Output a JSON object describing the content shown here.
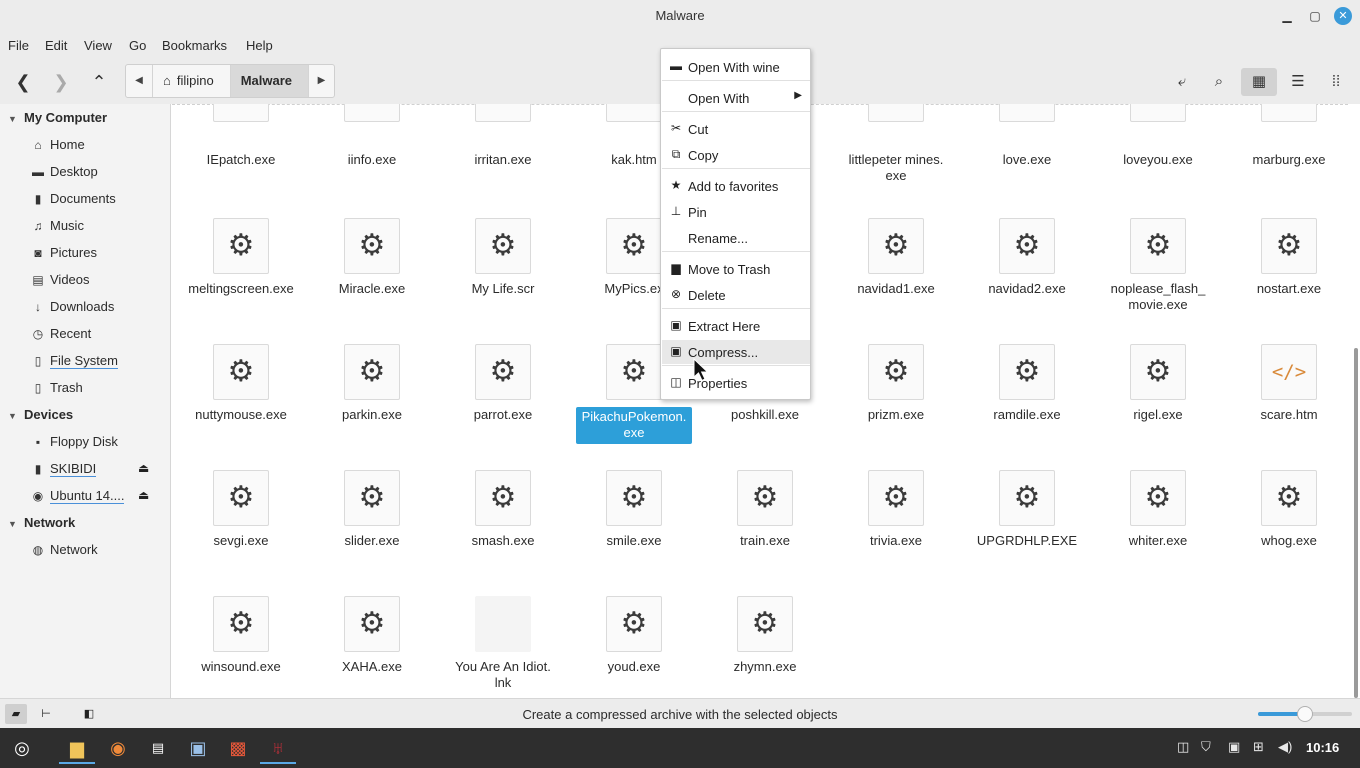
{
  "window": {
    "title": "Malware"
  },
  "menubar": [
    "File",
    "Edit",
    "View",
    "Go",
    "Bookmarks",
    "Help"
  ],
  "breadcrumb": {
    "home": "filipino",
    "current": "Malware"
  },
  "sidebar": {
    "sections": [
      {
        "title": "My Computer",
        "items": [
          "Home",
          "Desktop",
          "Documents",
          "Music",
          "Pictures",
          "Videos",
          "Downloads",
          "Recent",
          "File System",
          "Trash"
        ]
      },
      {
        "title": "Devices",
        "items": [
          "Floppy Disk",
          "SKIBIDI",
          "Ubuntu 14...."
        ]
      },
      {
        "title": "Network",
        "items": [
          "Network"
        ]
      }
    ],
    "usage": {
      "file_system": 0.8,
      "skibidi": 0.85,
      "ubuntu": 0.75
    }
  },
  "files": [
    {
      "name": "IEpatch.exe",
      "icon": "gear"
    },
    {
      "name": "iinfo.exe",
      "icon": "gear"
    },
    {
      "name": "irritan.exe",
      "icon": "gear"
    },
    {
      "name": "kak.htm",
      "icon": "code"
    },
    {
      "name": "",
      "icon": "hidden"
    },
    {
      "name": "littlepeter mines.",
      "name2": "exe",
      "icon": "gear"
    },
    {
      "name": "love.exe",
      "icon": "gear"
    },
    {
      "name": "loveyou.exe",
      "icon": "gear"
    },
    {
      "name": "marburg.exe",
      "icon": "gear"
    },
    {
      "name": "meltingscreen.exe",
      "icon": "gear"
    },
    {
      "name": "Miracle.exe",
      "icon": "gear"
    },
    {
      "name": "My Life.scr",
      "icon": "gear"
    },
    {
      "name": "MyPics.ex",
      "icon": "gear"
    },
    {
      "name": "",
      "icon": "hidden"
    },
    {
      "name": "navidad1.exe",
      "icon": "gear"
    },
    {
      "name": "navidad2.exe",
      "icon": "gear"
    },
    {
      "name": "noplease_flash_",
      "name2": "movie.exe",
      "icon": "gear"
    },
    {
      "name": "nostart.exe",
      "icon": "gear"
    },
    {
      "name": "nuttymouse.exe",
      "icon": "gear"
    },
    {
      "name": "parkin.exe",
      "icon": "gear"
    },
    {
      "name": "parrot.exe",
      "icon": "gear"
    },
    {
      "name": "PikachuPokemon.",
      "name2": "exe",
      "icon": "gear",
      "selected": true
    },
    {
      "name": "poshkill.exe",
      "icon": "hidden-icon"
    },
    {
      "name": "prizm.exe",
      "icon": "gear"
    },
    {
      "name": "ramdile.exe",
      "icon": "gear"
    },
    {
      "name": "rigel.exe",
      "icon": "gear"
    },
    {
      "name": "scare.htm",
      "icon": "code"
    },
    {
      "name": "sevgi.exe",
      "icon": "gear"
    },
    {
      "name": "slider.exe",
      "icon": "gear"
    },
    {
      "name": "smash.exe",
      "icon": "gear"
    },
    {
      "name": "smile.exe",
      "icon": "gear"
    },
    {
      "name": "train.exe",
      "icon": "gear"
    },
    {
      "name": "trivia.exe",
      "icon": "gear"
    },
    {
      "name": "UPGRDHLP.EXE",
      "icon": "gear"
    },
    {
      "name": "whiter.exe",
      "icon": "gear"
    },
    {
      "name": "whog.exe",
      "icon": "gear"
    },
    {
      "name": "winsound.exe",
      "icon": "gear"
    },
    {
      "name": "XAHA.exe",
      "icon": "gear"
    },
    {
      "name": "You Are An Idiot.",
      "name2": "lnk",
      "icon": "doc"
    },
    {
      "name": "youd.exe",
      "icon": "gear"
    },
    {
      "name": "zhymn.exe",
      "icon": "gear"
    }
  ],
  "context_menu": [
    {
      "label": "Open With wine",
      "icon": "folder-icon"
    },
    {
      "label": "Open With",
      "icon": "",
      "submenu": true
    },
    {
      "label": "Cut",
      "icon": "scissors-icon"
    },
    {
      "label": "Copy",
      "icon": "copy-icon"
    },
    {
      "label": "Add to favorites",
      "icon": "star-icon"
    },
    {
      "label": "Pin",
      "icon": "pin-icon"
    },
    {
      "label": "Rename...",
      "icon": ""
    },
    {
      "label": "Move to Trash",
      "icon": "trash-icon"
    },
    {
      "label": "Delete",
      "icon": "delete-icon"
    },
    {
      "label": "Extract Here",
      "icon": "extract-icon"
    },
    {
      "label": "Compress...",
      "icon": "compress-icon",
      "hover": true
    },
    {
      "label": "Properties",
      "icon": "properties-icon"
    }
  ],
  "status": {
    "text": "Create a compressed archive with the selected objects",
    "zoom_level": 0.5
  },
  "taskbar": {
    "clock": "10:16"
  },
  "colors": {
    "accent": "#2d9fd9",
    "selection": "#2d9fd9",
    "taskbar": "#2e2e2e"
  }
}
